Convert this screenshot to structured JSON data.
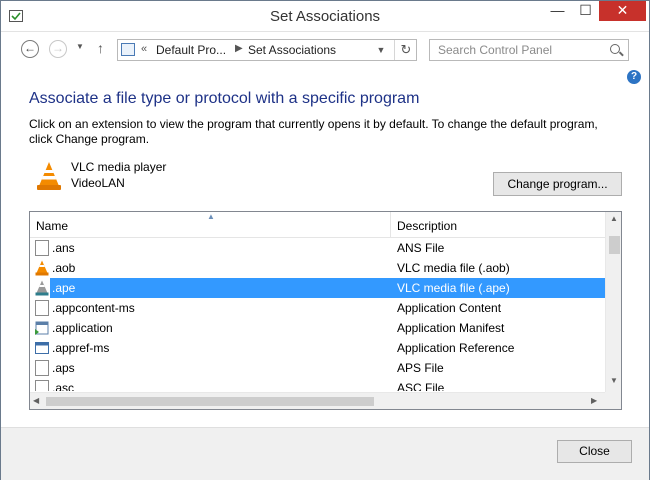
{
  "window": {
    "title": "Set Associations",
    "controls": {
      "minimize": "—",
      "maximize": "☐",
      "close": "✕"
    }
  },
  "nav": {
    "back_icon": "arrow-left-icon",
    "forward_icon": "arrow-right-icon",
    "up_icon": "arrow-up-icon",
    "breadcrumb": {
      "overflow": "«",
      "items": [
        "Default Pro...",
        "Set Associations"
      ]
    },
    "search": {
      "placeholder": "Search Control Panel"
    }
  },
  "content": {
    "heading": "Associate a file type or protocol with a specific program",
    "description": "Click on an extension to view the program that currently opens it by default. To change the default program, click Change program.",
    "program": {
      "name": "VLC media player",
      "vendor": "VideoLAN"
    },
    "change_button": "Change program..."
  },
  "list": {
    "columns": [
      "Name",
      "Description"
    ],
    "rows": [
      {
        "name": ".ans",
        "description": "ANS File",
        "icon": "blank-doc-icon",
        "selected": false
      },
      {
        "name": ".aob",
        "description": "VLC media file (.aob)",
        "icon": "vlc-cone-icon",
        "selected": false
      },
      {
        "name": ".ape",
        "description": "VLC media file (.ape)",
        "icon": "vlc-cone-icon",
        "selected": true
      },
      {
        "name": ".appcontent-ms",
        "description": "Application Content",
        "icon": "blank-doc-icon",
        "selected": false
      },
      {
        "name": ".application",
        "description": "Application Manifest",
        "icon": "app-manifest-icon",
        "selected": false
      },
      {
        "name": ".appref-ms",
        "description": "Application Reference",
        "icon": "window-icon",
        "selected": false
      },
      {
        "name": ".aps",
        "description": "APS File",
        "icon": "blank-doc-icon",
        "selected": false
      },
      {
        "name": ".asc",
        "description": "ASC File",
        "icon": "blank-doc-icon",
        "selected": false
      }
    ]
  },
  "footer": {
    "close_button": "Close"
  },
  "colors": {
    "heading": "#1e3287",
    "selection": "#3399ff",
    "close_control": "#c7312b"
  }
}
